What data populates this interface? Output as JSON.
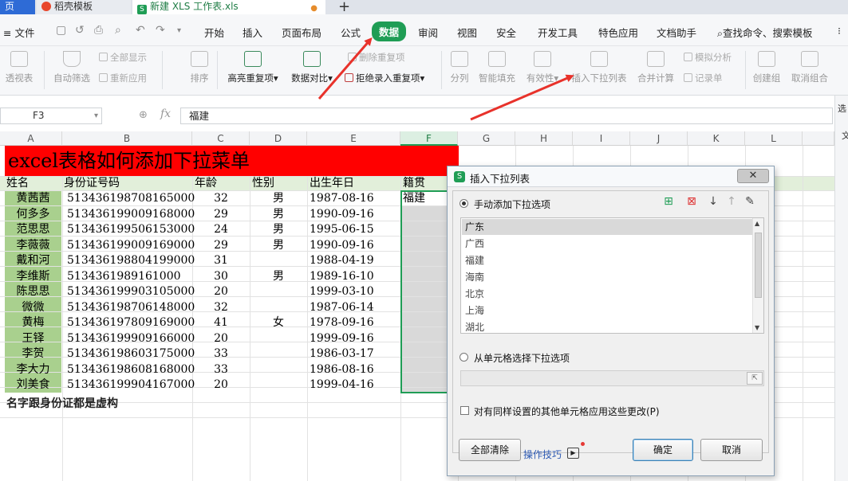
{
  "tabs": [
    {
      "label": "页"
    },
    {
      "label": "稻壳模板"
    },
    {
      "label": "新建 XLS 工作表.xls"
    }
  ],
  "tab_add": "+",
  "menu": {
    "file": "≡ 文件",
    "items": [
      "开始",
      "插入",
      "页面布局",
      "公式",
      "数据",
      "审阅",
      "视图",
      "安全",
      "开发工具",
      "特色应用",
      "文档助手"
    ],
    "active": "数据",
    "search": "查找命令、搜索模板"
  },
  "ribbon": {
    "pivot": "透视表",
    "autofilter": "自动筛选",
    "showall": "全部显示",
    "reapply": "重新应用",
    "sort": "排序",
    "highlight_dup": "高亮重复项",
    "data_compare": "数据对比",
    "delete_dup": "删除重复项",
    "reject_dup": "拒绝录入重复项",
    "split": "分列",
    "smart_fill": "智能填充",
    "validity": "有效性",
    "insert_dropdown": "插入下拉列表",
    "consolidate": "合并计算",
    "simulate": "模拟分析",
    "record": "记录单",
    "group": "创建组",
    "ungroup": "取消组合"
  },
  "formula_bar": {
    "cell_ref": "F3",
    "fx": "fx",
    "value": "福建"
  },
  "right_pane": {
    "t1": "选",
    "t2": "文"
  },
  "grid": {
    "columns": [
      "A",
      "B",
      "C",
      "D",
      "E",
      "F",
      "G",
      "H",
      "I",
      "J",
      "K",
      "L"
    ],
    "title": "excel表格如何添加下拉菜单",
    "headers": [
      "姓名",
      "身份证号码",
      "年龄",
      "性别",
      "出生年日",
      "籍贯"
    ],
    "rows": [
      {
        "name": "黄茜茜",
        "id": "513436198708165000",
        "age": "32",
        "sex": "男",
        "birth": "1987-08-16",
        "place": "福建"
      },
      {
        "name": "何多多",
        "id": "513436199009168000",
        "age": "29",
        "sex": "男",
        "birth": "1990-09-16",
        "place": ""
      },
      {
        "name": "范思思",
        "id": "513436199506153000",
        "age": "24",
        "sex": "男",
        "birth": "1995-06-15",
        "place": ""
      },
      {
        "name": "李薇薇",
        "id": "513436199009169000",
        "age": "29",
        "sex": "男",
        "birth": "1990-09-16",
        "place": ""
      },
      {
        "name": "戴和河",
        "id": "513436198804199000",
        "age": "31",
        "sex": "",
        "birth": "1988-04-19",
        "place": ""
      },
      {
        "name": "李维斯",
        "id": "5134361989161000",
        "age": "30",
        "sex": "男",
        "birth": "1989-16-10",
        "place": ""
      },
      {
        "name": "陈思思",
        "id": "513436199903105000",
        "age": "20",
        "sex": "",
        "birth": "1999-03-10",
        "place": ""
      },
      {
        "name": "微微",
        "id": "513436198706148000",
        "age": "32",
        "sex": "",
        "birth": "1987-06-14",
        "place": ""
      },
      {
        "name": "黄梅",
        "id": "513436197809169000",
        "age": "41",
        "sex": "女",
        "birth": "1978-09-16",
        "place": ""
      },
      {
        "name": "王铎",
        "id": "513436199909166000",
        "age": "20",
        "sex": "",
        "birth": "1999-09-16",
        "place": ""
      },
      {
        "name": "李贺",
        "id": "513436198603175000",
        "age": "33",
        "sex": "",
        "birth": "1986-03-17",
        "place": ""
      },
      {
        "name": "李大力",
        "id": "513436198608168000",
        "age": "33",
        "sex": "",
        "birth": "1986-08-16",
        "place": ""
      },
      {
        "name": "刘美食",
        "id": "513436199904167000",
        "age": "20",
        "sex": "",
        "birth": "1999-04-16",
        "place": ""
      }
    ],
    "footnote": "名字跟身份证都是虚构"
  },
  "dialog": {
    "title": "插入下拉列表",
    "close": "✕",
    "manual_option": "手动添加下拉选项",
    "items": [
      "广东",
      "广西",
      "福建",
      "海南",
      "北京",
      "上海",
      "湖北"
    ],
    "selected_item": "广东",
    "cell_option": "从单元格选择下拉选项",
    "apply_all": "对有同样设置的其他单元格应用这些更改(P)",
    "clear_all": "全部清除",
    "tips": "操作技巧",
    "ok": "确定",
    "cancel": "取消"
  },
  "colors": {
    "accent": "#1f9d55",
    "title_bg": "#ff0000",
    "name_col_bg": "#a9d08e",
    "header_row_bg": "#e2efda",
    "arrow": "#e8322b"
  }
}
